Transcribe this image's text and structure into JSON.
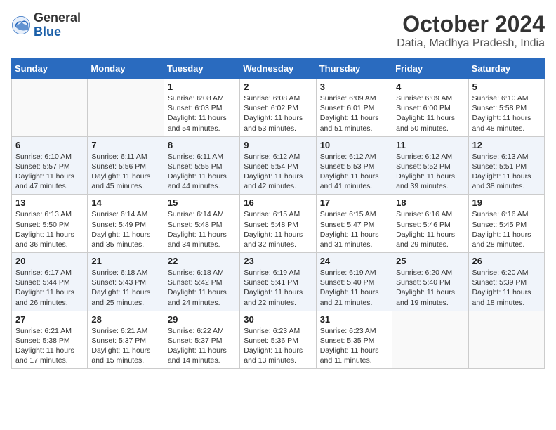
{
  "logo": {
    "general": "General",
    "blue": "Blue"
  },
  "title": "October 2024",
  "subtitle": "Datia, Madhya Pradesh, India",
  "headers": [
    "Sunday",
    "Monday",
    "Tuesday",
    "Wednesday",
    "Thursday",
    "Friday",
    "Saturday"
  ],
  "weeks": [
    [
      {
        "day": "",
        "info": ""
      },
      {
        "day": "",
        "info": ""
      },
      {
        "day": "1",
        "info": "Sunrise: 6:08 AM\nSunset: 6:03 PM\nDaylight: 11 hours and 54 minutes."
      },
      {
        "day": "2",
        "info": "Sunrise: 6:08 AM\nSunset: 6:02 PM\nDaylight: 11 hours and 53 minutes."
      },
      {
        "day": "3",
        "info": "Sunrise: 6:09 AM\nSunset: 6:01 PM\nDaylight: 11 hours and 51 minutes."
      },
      {
        "day": "4",
        "info": "Sunrise: 6:09 AM\nSunset: 6:00 PM\nDaylight: 11 hours and 50 minutes."
      },
      {
        "day": "5",
        "info": "Sunrise: 6:10 AM\nSunset: 5:58 PM\nDaylight: 11 hours and 48 minutes."
      }
    ],
    [
      {
        "day": "6",
        "info": "Sunrise: 6:10 AM\nSunset: 5:57 PM\nDaylight: 11 hours and 47 minutes."
      },
      {
        "day": "7",
        "info": "Sunrise: 6:11 AM\nSunset: 5:56 PM\nDaylight: 11 hours and 45 minutes."
      },
      {
        "day": "8",
        "info": "Sunrise: 6:11 AM\nSunset: 5:55 PM\nDaylight: 11 hours and 44 minutes."
      },
      {
        "day": "9",
        "info": "Sunrise: 6:12 AM\nSunset: 5:54 PM\nDaylight: 11 hours and 42 minutes."
      },
      {
        "day": "10",
        "info": "Sunrise: 6:12 AM\nSunset: 5:53 PM\nDaylight: 11 hours and 41 minutes."
      },
      {
        "day": "11",
        "info": "Sunrise: 6:12 AM\nSunset: 5:52 PM\nDaylight: 11 hours and 39 minutes."
      },
      {
        "day": "12",
        "info": "Sunrise: 6:13 AM\nSunset: 5:51 PM\nDaylight: 11 hours and 38 minutes."
      }
    ],
    [
      {
        "day": "13",
        "info": "Sunrise: 6:13 AM\nSunset: 5:50 PM\nDaylight: 11 hours and 36 minutes."
      },
      {
        "day": "14",
        "info": "Sunrise: 6:14 AM\nSunset: 5:49 PM\nDaylight: 11 hours and 35 minutes."
      },
      {
        "day": "15",
        "info": "Sunrise: 6:14 AM\nSunset: 5:48 PM\nDaylight: 11 hours and 34 minutes."
      },
      {
        "day": "16",
        "info": "Sunrise: 6:15 AM\nSunset: 5:48 PM\nDaylight: 11 hours and 32 minutes."
      },
      {
        "day": "17",
        "info": "Sunrise: 6:15 AM\nSunset: 5:47 PM\nDaylight: 11 hours and 31 minutes."
      },
      {
        "day": "18",
        "info": "Sunrise: 6:16 AM\nSunset: 5:46 PM\nDaylight: 11 hours and 29 minutes."
      },
      {
        "day": "19",
        "info": "Sunrise: 6:16 AM\nSunset: 5:45 PM\nDaylight: 11 hours and 28 minutes."
      }
    ],
    [
      {
        "day": "20",
        "info": "Sunrise: 6:17 AM\nSunset: 5:44 PM\nDaylight: 11 hours and 26 minutes."
      },
      {
        "day": "21",
        "info": "Sunrise: 6:18 AM\nSunset: 5:43 PM\nDaylight: 11 hours and 25 minutes."
      },
      {
        "day": "22",
        "info": "Sunrise: 6:18 AM\nSunset: 5:42 PM\nDaylight: 11 hours and 24 minutes."
      },
      {
        "day": "23",
        "info": "Sunrise: 6:19 AM\nSunset: 5:41 PM\nDaylight: 11 hours and 22 minutes."
      },
      {
        "day": "24",
        "info": "Sunrise: 6:19 AM\nSunset: 5:40 PM\nDaylight: 11 hours and 21 minutes."
      },
      {
        "day": "25",
        "info": "Sunrise: 6:20 AM\nSunset: 5:40 PM\nDaylight: 11 hours and 19 minutes."
      },
      {
        "day": "26",
        "info": "Sunrise: 6:20 AM\nSunset: 5:39 PM\nDaylight: 11 hours and 18 minutes."
      }
    ],
    [
      {
        "day": "27",
        "info": "Sunrise: 6:21 AM\nSunset: 5:38 PM\nDaylight: 11 hours and 17 minutes."
      },
      {
        "day": "28",
        "info": "Sunrise: 6:21 AM\nSunset: 5:37 PM\nDaylight: 11 hours and 15 minutes."
      },
      {
        "day": "29",
        "info": "Sunrise: 6:22 AM\nSunset: 5:37 PM\nDaylight: 11 hours and 14 minutes."
      },
      {
        "day": "30",
        "info": "Sunrise: 6:23 AM\nSunset: 5:36 PM\nDaylight: 11 hours and 13 minutes."
      },
      {
        "day": "31",
        "info": "Sunrise: 6:23 AM\nSunset: 5:35 PM\nDaylight: 11 hours and 11 minutes."
      },
      {
        "day": "",
        "info": ""
      },
      {
        "day": "",
        "info": ""
      }
    ]
  ]
}
